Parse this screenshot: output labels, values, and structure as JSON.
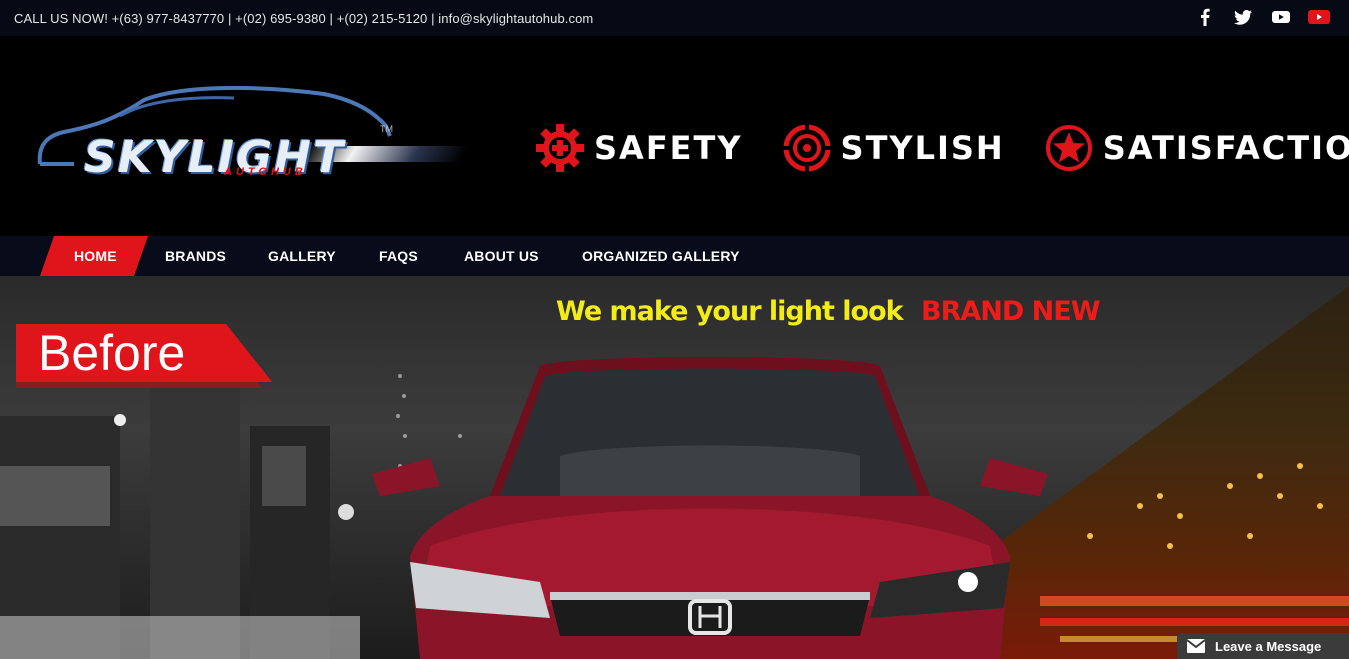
{
  "topbar": {
    "contact": "CALL US NOW! +(63) 977-8437770 | +(02) 695-9380 | +(02) 215-5120 | info@skylightautohub.com",
    "social_icons": [
      "facebook-icon",
      "twitter-icon",
      "youtube-icon",
      "youtube-icon"
    ]
  },
  "logo": {
    "main": "SKYLIGHT",
    "sub": "AUTOHUB",
    "tm": "TM"
  },
  "values": [
    {
      "label": "SAFETY",
      "icon": "gear-plus-icon"
    },
    {
      "label": "STYLISH",
      "icon": "target-icon"
    },
    {
      "label": "SATISFACTION",
      "icon": "star-icon"
    }
  ],
  "nav": {
    "items": [
      "HOME",
      "BRANDS",
      "GALLERY",
      "FAQS",
      "ABOUT US",
      "ORGANIZED GALLERY"
    ],
    "active": "HOME"
  },
  "hero": {
    "tagline_yellow": "We make your light look",
    "tagline_red": "BRAND NEW",
    "before_label": "Before"
  },
  "chat": {
    "label": "Leave a Message",
    "icon": "envelope-icon"
  },
  "colors": {
    "accent": "#e0151b",
    "nav_bg": "#070b1a",
    "tagline_yellow": "#f4ec17"
  }
}
